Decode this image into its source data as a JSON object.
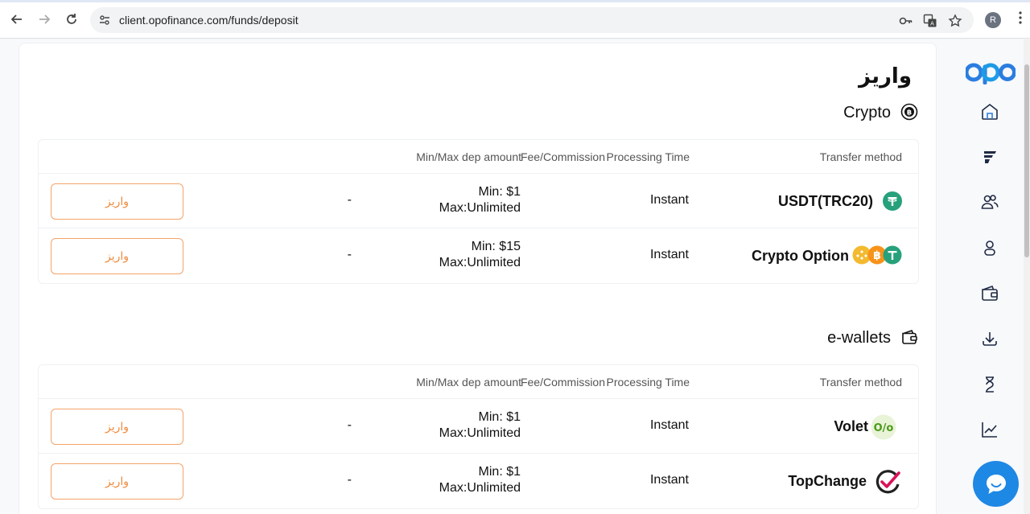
{
  "browser": {
    "url": "client.opofinance.com/funds/deposit",
    "profile_initial": "R"
  },
  "page": {
    "title": "واریز"
  },
  "sections": [
    {
      "title": "Crypto",
      "headers": {
        "fee": "Fee/Commission",
        "minmax": "Min/Max dep amount",
        "processing": "Processing Time",
        "method": "Transfer method"
      },
      "rows": [
        {
          "method": "USDT(TRC20)",
          "processing": "Instant",
          "min": "Min: $1",
          "max": "Max:Unlimited",
          "fee": "-",
          "button": "واریز"
        },
        {
          "method": "Crypto Option",
          "processing": "Instant",
          "min": "Min: $15",
          "max": "Max:Unlimited",
          "fee": "-",
          "button": "واریز"
        }
      ]
    },
    {
      "title": "e-wallets",
      "headers": {
        "fee": "Fee/Commission",
        "minmax": "Min/Max dep amount",
        "processing": "Processing Time",
        "method": "Transfer method"
      },
      "rows": [
        {
          "method": "Volet",
          "processing": "Instant",
          "min": "Min: $1",
          "max": "Max:Unlimited",
          "fee": "-",
          "button": "واریز"
        },
        {
          "method": "TopChange",
          "processing": "Instant",
          "min": "Min: $1",
          "max": "Max:Unlimited",
          "fee": "-",
          "button": "واریز"
        }
      ]
    }
  ],
  "volet_logo_text": "O/o",
  "colors": {
    "accent_orange": "#f08a3c",
    "tether_green": "#26a17b",
    "brand_blue": "#1e88e5"
  }
}
